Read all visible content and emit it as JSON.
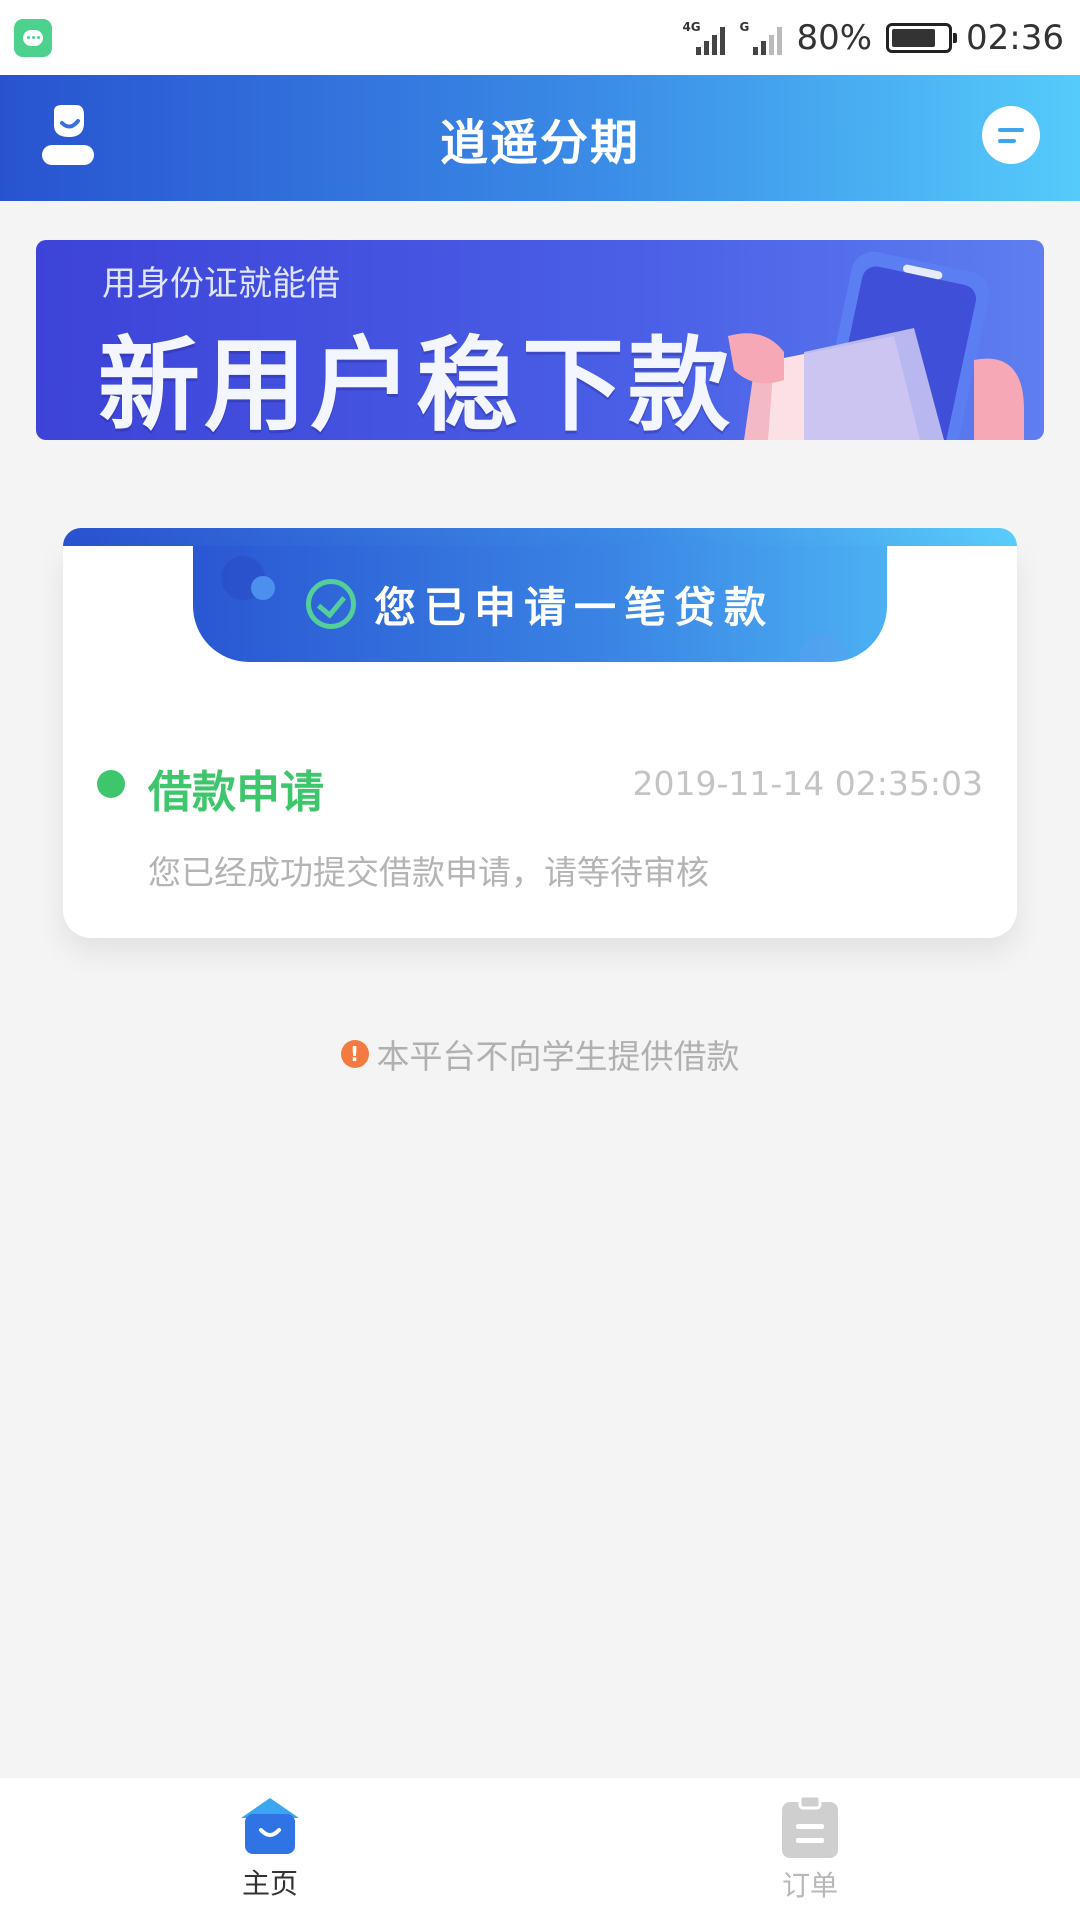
{
  "status_bar": {
    "network1": "4G",
    "network2": "G",
    "battery_pct": "80%",
    "battery_level": 0.8,
    "time": "02:36",
    "notification_icon": "message-icon"
  },
  "header": {
    "title": "逍遥分期",
    "left_icon": "user-icon",
    "right_icon": "message-icon"
  },
  "banner": {
    "subtitle": "用身份证就能借",
    "headline": "新用户稳下款"
  },
  "card": {
    "header": "您已申请一笔贷款",
    "status": "借款申请",
    "time": "2019-11-14 02:35:03",
    "description": "您已经成功提交借款申请，请等待审核",
    "status_color": "#3ec66c"
  },
  "notice": {
    "text": "本平台不向学生提供借款",
    "icon": "warning-icon"
  },
  "bottom_nav": {
    "items": [
      {
        "label": "主页",
        "icon": "home-icon",
        "active": true
      },
      {
        "label": "订单",
        "icon": "clipboard-icon",
        "active": false
      }
    ]
  },
  "colors": {
    "brand_blue": "#2f6fe0",
    "accent_cyan": "#55cbfb",
    "success_green": "#3ec66c",
    "warning_orange": "#f47a42"
  }
}
